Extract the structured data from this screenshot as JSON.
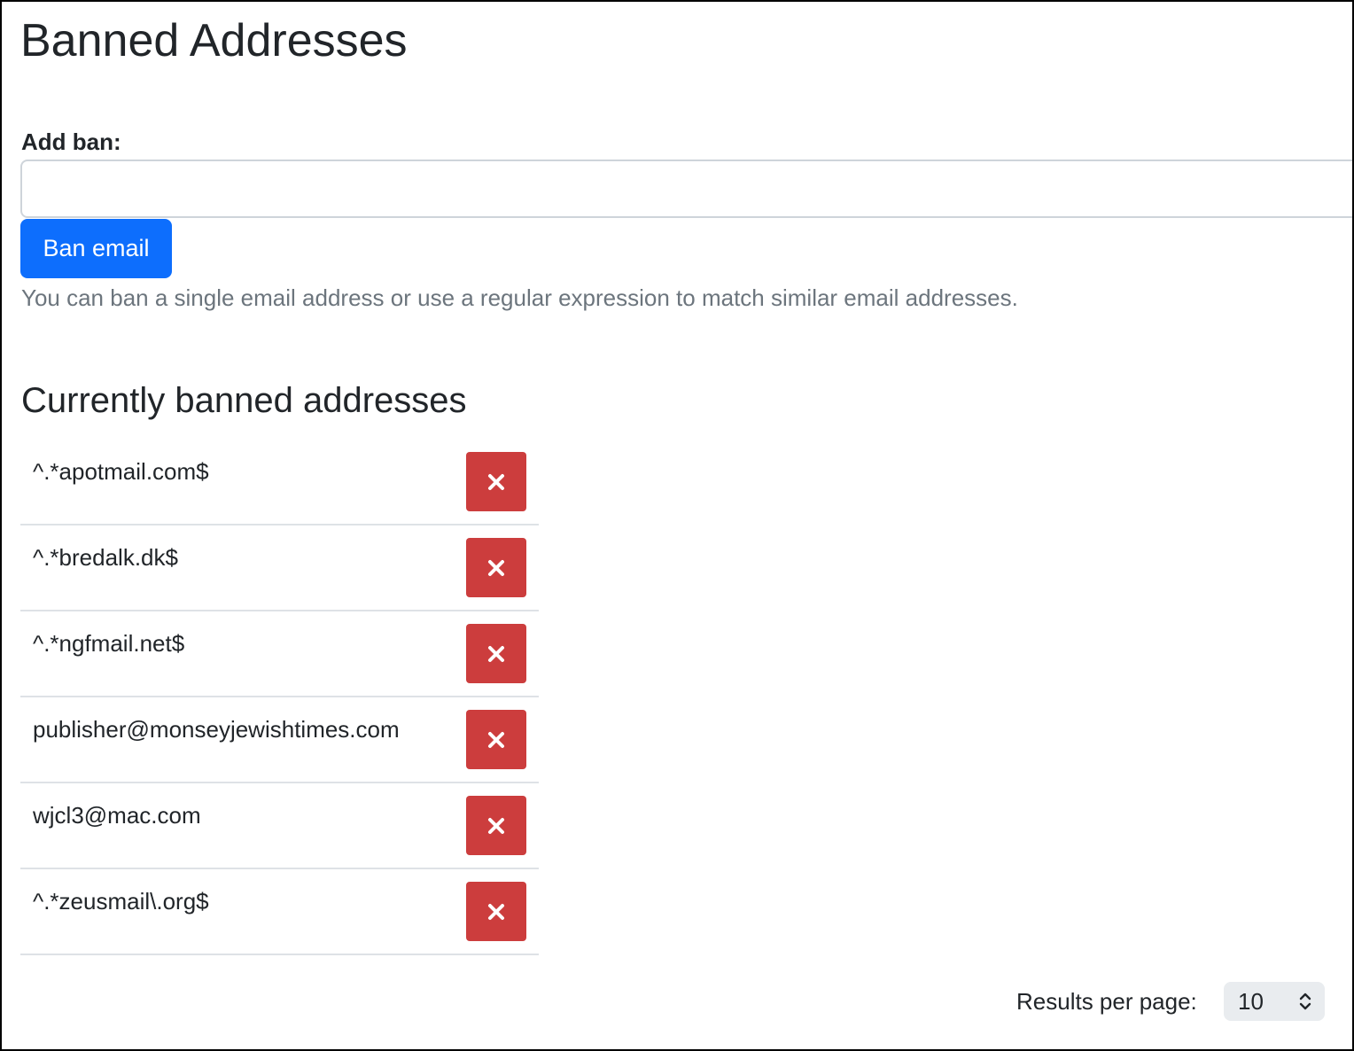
{
  "page": {
    "title": "Banned Addresses"
  },
  "add_ban": {
    "label": "Add ban:",
    "input_value": "",
    "input_placeholder": "",
    "button_label": "Ban email",
    "help_text": "You can ban a single email address or use a regular expression to match similar email addresses."
  },
  "banned": {
    "title": "Currently banned addresses",
    "items": [
      {
        "address": "^.*apotmail.com$",
        "remove_icon": "close-icon"
      },
      {
        "address": "^.*bredalk.dk$",
        "remove_icon": "close-icon"
      },
      {
        "address": "^.*ngfmail.net$",
        "remove_icon": "close-icon"
      },
      {
        "address": "publisher@monseyjewishtimes.com",
        "remove_icon": "close-icon"
      },
      {
        "address": "wjcl3@mac.com",
        "remove_icon": "close-icon"
      },
      {
        "address": "^.*zeusmail\\.org$",
        "remove_icon": "close-icon"
      }
    ]
  },
  "pagination": {
    "results_label": "Results per page:",
    "results_value": "10",
    "select_icon": "chevron-up-down-icon"
  },
  "colors": {
    "primary": "#0d6efd",
    "danger": "#cc3d3d",
    "muted_text": "#6c757d",
    "border": "#dee2e6",
    "select_bg": "#e9ecef"
  }
}
